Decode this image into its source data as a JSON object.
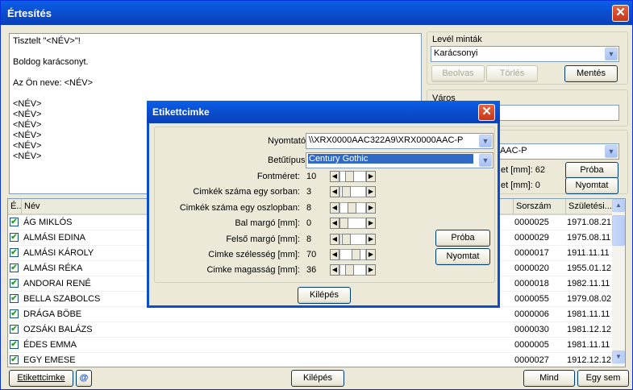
{
  "window": {
    "title": "Értesítés",
    "close": "✕"
  },
  "letter_text": "Tisztelt \"<NÉV>\"!\n\nBoldog karácsonyt.\n\nAz Ön neve: <NÉV>\n\n<NÉV>\n<NÉV>\n<NÉV>\n<NÉV>\n<NÉV>\n<NÉV>",
  "templates": {
    "label": "Levél minták",
    "value": "Karácsonyi",
    "beolvas": "Beolvas",
    "torles": "Törlés",
    "mentes": "Mentés"
  },
  "city": {
    "label": "Város"
  },
  "printer_bg": {
    "value": "322A9\\XRX0000AAC-P",
    "left_margin": "et [mm]: 62",
    "top_margin": "et [mm]: 0",
    "proba": "Próba",
    "nyomtat": "Nyomtat"
  },
  "grid": {
    "columns": [
      "É...",
      "Név",
      "Sorszám",
      "Születési..."
    ],
    "rows": [
      {
        "checked": true,
        "name": "ÁG MIKLÓS",
        "no": "0000025",
        "birth": "1971.08.21"
      },
      {
        "checked": true,
        "name": "ALMÁSI EDINA",
        "no": "0000029",
        "birth": "1975.08.11"
      },
      {
        "checked": true,
        "name": "ALMÁSI KÁROLY",
        "no": "0000017",
        "birth": "1911.11.11"
      },
      {
        "checked": true,
        "name": "ALMÁSI RÉKA",
        "no": "0000020",
        "birth": "1955.01.12"
      },
      {
        "checked": true,
        "name": "ANDORAI RENÉ",
        "no": "0000018",
        "birth": "1982.11.11"
      },
      {
        "checked": true,
        "name": "BELLA SZABOLCS",
        "no": "0000055",
        "birth": "1979.08.02"
      },
      {
        "checked": true,
        "name": "DRÁGA BÖBE",
        "no": "0000006",
        "birth": "1981.11.11"
      },
      {
        "checked": true,
        "name": "OZSÁKI BALÁZS",
        "no": "0000030",
        "birth": "1981.12.12"
      },
      {
        "checked": true,
        "name": "ÉDES EMMA",
        "no": "0000005",
        "birth": "1981.11.11"
      },
      {
        "checked": true,
        "name": "EGY EMESE",
        "no": "0000027",
        "birth": "1912.12.12"
      }
    ]
  },
  "bottom": {
    "etikett": "Etikettcimke",
    "at": "@",
    "kilepes": "Kilépés",
    "mind": "Mind",
    "egy_sem": "Egy sem"
  },
  "dialog": {
    "title": "Etikettcimke",
    "close": "✕",
    "printer_label": "Nyomtató",
    "printer_value": "\\\\XRX0000AAC322A9\\XRX0000AAC-P",
    "font_label": "Betűtípus",
    "font_value": "Century Gothic",
    "fields": [
      {
        "label": "Fontméret:",
        "value": "10",
        "pos": 0.3
      },
      {
        "label": "Cimkék száma egy sorban:",
        "value": "3",
        "pos": 0.15
      },
      {
        "label": "Cimkék száma egy oszlopban:",
        "value": "8",
        "pos": 0.45
      },
      {
        "label": "Bal margó [mm]:",
        "value": "0",
        "pos": 0.0
      },
      {
        "label": "Felső margó [mm]:",
        "value": "8",
        "pos": 0.15
      },
      {
        "label": "Cimke szélesség [mm]:",
        "value": "70",
        "pos": 0.7
      },
      {
        "label": "Cimke magasság [mm]:",
        "value": "36",
        "pos": 0.3
      }
    ],
    "proba": "Próba",
    "nyomtat": "Nyomtat",
    "kilepes": "Kilépés"
  }
}
